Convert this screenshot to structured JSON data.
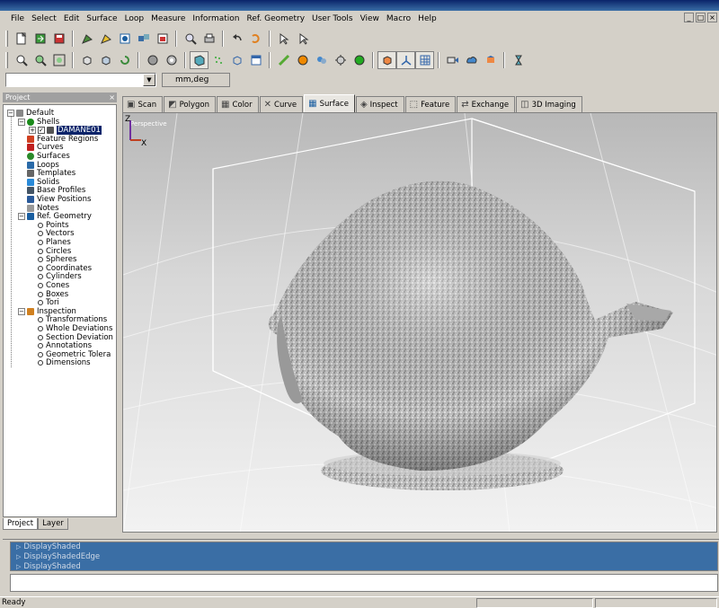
{
  "menu": [
    "File",
    "Select",
    "Edit",
    "Surface",
    "Loop",
    "Measure",
    "Information",
    "Ref. Geometry",
    "User Tools",
    "View",
    "Macro",
    "Help"
  ],
  "window_controls": [
    "_",
    "□",
    "×"
  ],
  "units": {
    "value": "",
    "label": "mm,deg"
  },
  "project_panel": {
    "title": "Project",
    "tree": [
      {
        "label": "Default",
        "level": 0,
        "icon": "folder-icon",
        "expander": "−"
      },
      {
        "label": "Shells",
        "level": 1,
        "icon": "shell-icon",
        "expander": "−"
      },
      {
        "label": "DAMANE01",
        "level": 2,
        "icon": "mesh-icon",
        "expander": "+",
        "check": "✓"
      },
      {
        "label": "Feature Regions",
        "level": 1,
        "icon": "region-icon"
      },
      {
        "label": "Curves",
        "level": 1,
        "icon": "curve-icon"
      },
      {
        "label": "Surfaces",
        "level": 1,
        "icon": "surface-icon"
      },
      {
        "label": "Loops",
        "level": 1,
        "icon": "loop-icon"
      },
      {
        "label": "Templates",
        "level": 1,
        "icon": "template-icon"
      },
      {
        "label": "Solids",
        "level": 1,
        "icon": "solid-icon"
      },
      {
        "label": "Base Profiles",
        "level": 1,
        "icon": "profile-icon"
      },
      {
        "label": "View Positions",
        "level": 1,
        "icon": "view-icon"
      },
      {
        "label": "Notes",
        "level": 1,
        "icon": "note-icon"
      },
      {
        "label": "Ref. Geometry",
        "level": 1,
        "icon": "refgeo-icon",
        "expander": "−"
      },
      {
        "label": "Points",
        "level": 2,
        "icon": "point-icon"
      },
      {
        "label": "Vectors",
        "level": 2,
        "icon": "vector-icon"
      },
      {
        "label": "Planes",
        "level": 2,
        "icon": "plane-icon"
      },
      {
        "label": "Circles",
        "level": 2,
        "icon": "circle-icon"
      },
      {
        "label": "Spheres",
        "level": 2,
        "icon": "sphere-icon"
      },
      {
        "label": "Coordinates",
        "level": 2,
        "icon": "coord-icon"
      },
      {
        "label": "Cylinders",
        "level": 2,
        "icon": "cylinder-icon"
      },
      {
        "label": "Cones",
        "level": 2,
        "icon": "cone-icon"
      },
      {
        "label": "Boxes",
        "level": 2,
        "icon": "box-icon"
      },
      {
        "label": "Tori",
        "level": 2,
        "icon": "torus-icon"
      },
      {
        "label": "Inspection",
        "level": 1,
        "icon": "inspection-icon",
        "expander": "−"
      },
      {
        "label": "Transformations",
        "level": 2,
        "icon": "transform-icon"
      },
      {
        "label": "Whole Deviations",
        "level": 2,
        "icon": "deviation-icon"
      },
      {
        "label": "Section Deviation",
        "level": 2,
        "icon": "section-icon"
      },
      {
        "label": "Annotations",
        "level": 2,
        "icon": "annotation-icon"
      },
      {
        "label": "Geometric Tolera",
        "level": 2,
        "icon": "tolerance-icon"
      },
      {
        "label": "Dimensions",
        "level": 2,
        "icon": "dimension-icon"
      }
    ],
    "tabs": [
      "Project",
      "Layer"
    ]
  },
  "workspace_tabs": [
    {
      "label": "Scan",
      "icon": "scan-icon"
    },
    {
      "label": "Polygon",
      "icon": "polygon-icon"
    },
    {
      "label": "Color",
      "icon": "color-icon"
    },
    {
      "label": "Curve",
      "icon": "curve-tab-icon"
    },
    {
      "label": "Surface",
      "icon": "surface-tab-icon",
      "active": true
    },
    {
      "label": "Inspect",
      "icon": "inspect-icon"
    },
    {
      "label": "Feature",
      "icon": "feature-icon"
    },
    {
      "label": "Exchange",
      "icon": "exchange-icon"
    },
    {
      "label": "3D Imaging",
      "icon": "imaging-icon"
    }
  ],
  "viewport": {
    "mode": "Perspective",
    "axis_labels": {
      "z": "Z",
      "x": "X"
    },
    "model_name": "DAMANE01"
  },
  "output": {
    "lines": [
      "DisplayShaded",
      "DisplayShadedEdge",
      "DisplayShaded"
    ],
    "command": ""
  },
  "status": {
    "text": "Ready"
  },
  "colors": {
    "chrome": "#d4d0c8",
    "title_gradient_start": "#0a246a",
    "output_bg": "#3a6ea5",
    "mesh": "#c8c8c8"
  }
}
